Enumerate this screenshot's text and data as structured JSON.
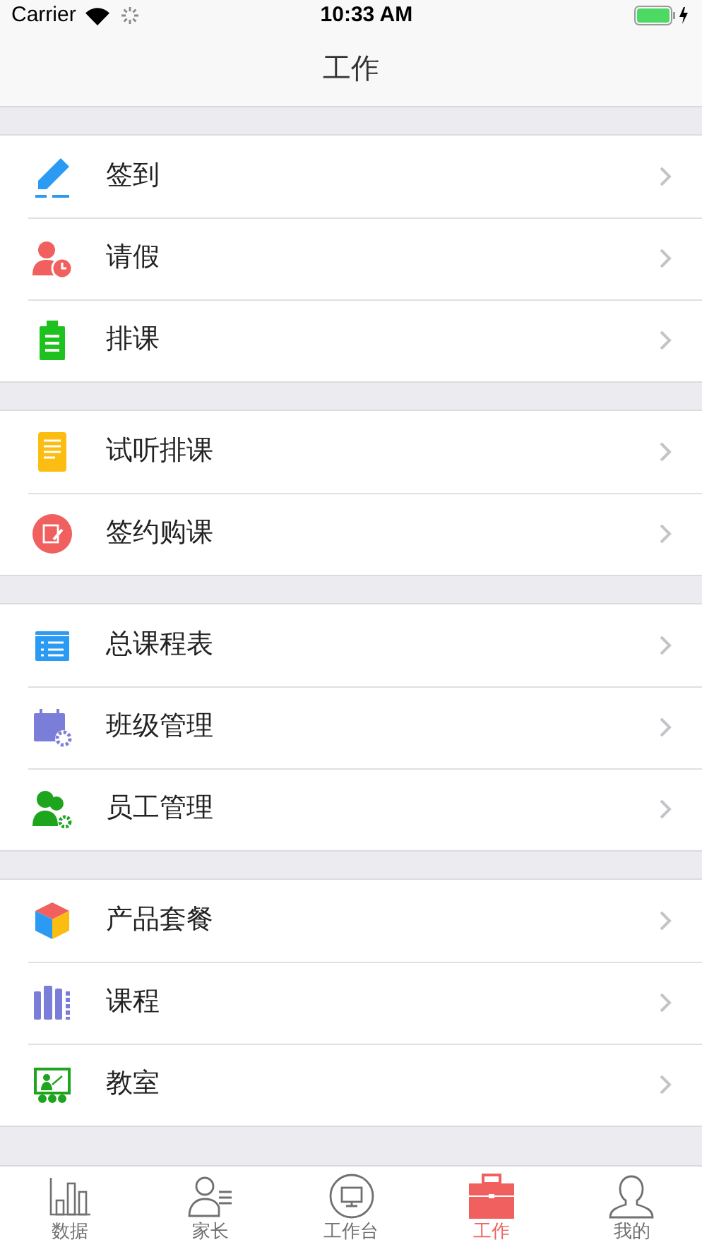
{
  "status_bar": {
    "carrier": "Carrier",
    "time": "10:33 AM"
  },
  "nav_bar": {
    "title": "工作"
  },
  "groups": [
    {
      "items": [
        {
          "label": "签到"
        },
        {
          "label": "请假"
        },
        {
          "label": "排课"
        }
      ]
    },
    {
      "items": [
        {
          "label": "试听排课"
        },
        {
          "label": "签约购课"
        }
      ]
    },
    {
      "items": [
        {
          "label": "总课程表"
        },
        {
          "label": "班级管理"
        },
        {
          "label": "员工管理"
        }
      ]
    },
    {
      "items": [
        {
          "label": "产品套餐"
        },
        {
          "label": "课程"
        },
        {
          "label": "教室"
        }
      ]
    }
  ],
  "tab_bar": [
    {
      "label": "数据",
      "selected": false
    },
    {
      "label": "家长",
      "selected": false
    },
    {
      "label": "工作台",
      "selected": false
    },
    {
      "label": "工作",
      "selected": true
    },
    {
      "label": "我的",
      "selected": false
    }
  ]
}
